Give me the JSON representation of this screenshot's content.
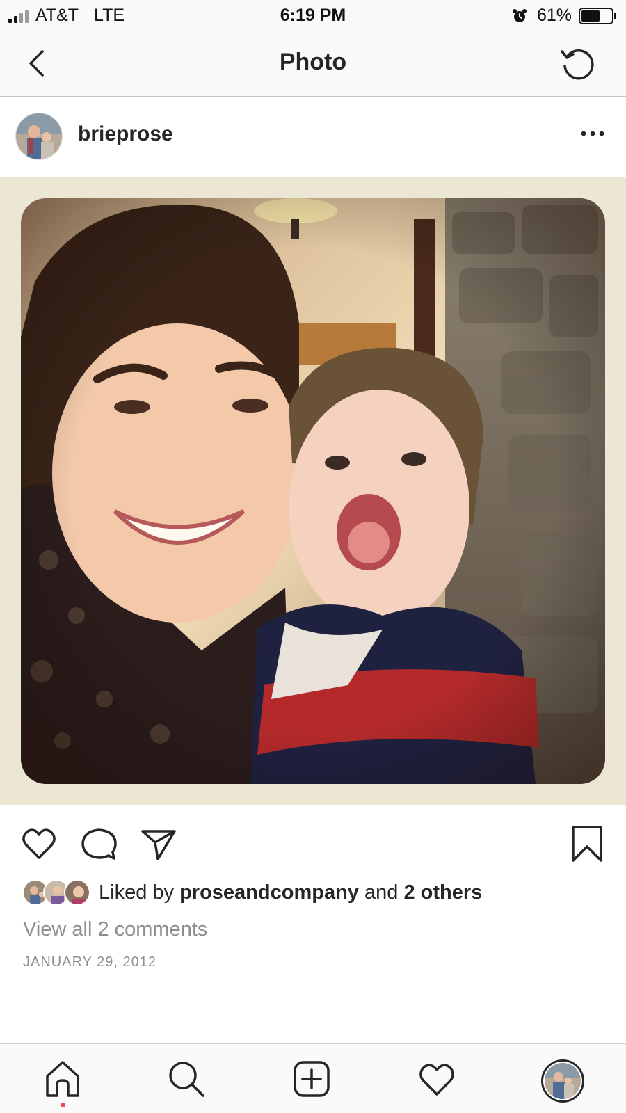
{
  "status_bar": {
    "carrier": "AT&T",
    "network": "LTE",
    "time": "6:19 PM",
    "battery": "61%",
    "battery_level": 0.61
  },
  "nav": {
    "title": "Photo",
    "back_icon": "chevron-left-icon",
    "refresh_icon": "refresh-icon"
  },
  "post": {
    "username": "brieprose",
    "more_icon": "ellipsis-icon",
    "likes": {
      "prefix": "Liked by",
      "user": "proseandcompany",
      "conjunction": "and",
      "others": "2 others"
    },
    "view_comments": "View all 2 comments",
    "date": "JANUARY 29, 2012"
  },
  "actions": [
    "heart-icon",
    "comment-icon",
    "share-icon",
    "bookmark-icon"
  ],
  "tabs": [
    "home-icon",
    "search-icon",
    "add-post-icon",
    "activity-icon",
    "profile-avatar"
  ],
  "colors": {
    "text": "#262626",
    "secondary_text": "#8e8e8e",
    "notification_dot": "#ed4956",
    "bar_bg": "#fafafa"
  }
}
